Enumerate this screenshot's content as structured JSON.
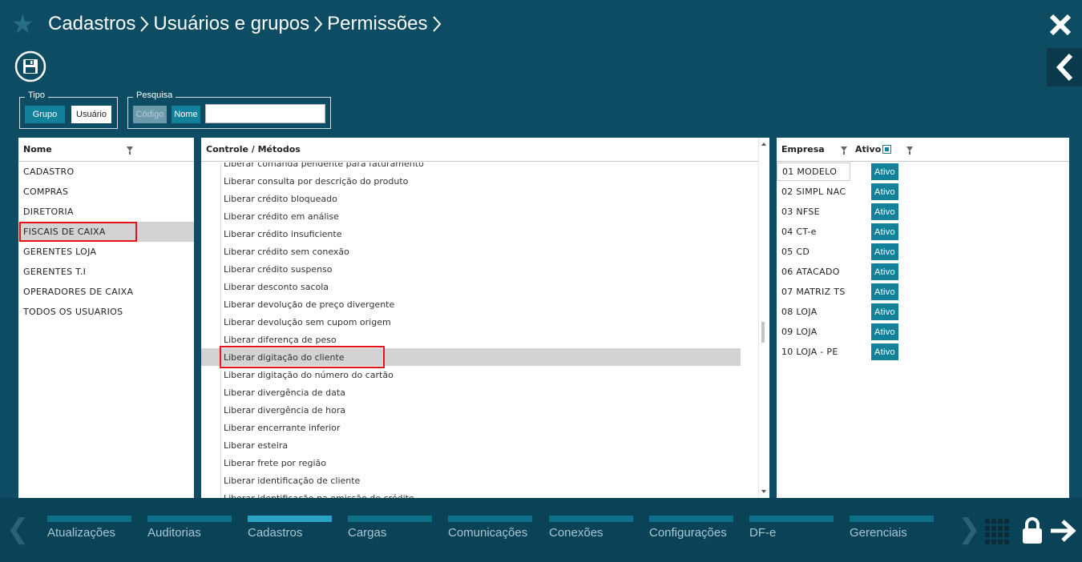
{
  "header": {
    "breadcrumb": [
      "Cadastros",
      "Usuários e grupos",
      "Permissões"
    ]
  },
  "tipo": {
    "legend": "Tipo",
    "grupo": "Grupo",
    "usuario": "Usuário"
  },
  "pesquisa": {
    "legend": "Pesquisa",
    "codigo": "Código",
    "nome": "Nome",
    "value": ""
  },
  "nome_panel": {
    "header": "Nome",
    "items": [
      "CADASTRO",
      "COMPRAS",
      "DIRETORIA",
      "FISCAIS DE CAIXA",
      "GERENTES LOJA",
      "GERENTES T.I",
      "OPERADORES DE CAIXA",
      "TODOS OS USUARIOS"
    ],
    "selected_index": 3
  },
  "controle_panel": {
    "header": "Controle / Métodos",
    "items": [
      "Liberar comanda pendente para faturamento",
      "Liberar consulta por descrição do produto",
      "Liberar crédito bloqueado",
      "Liberar crédito em análise",
      "Liberar crédito insuficiente",
      "Liberar crédito sem conexão",
      "Liberar crédito suspenso",
      "Liberar desconto sacola",
      "Liberar devolução de preço divergente",
      "Liberar devolução sem cupom origem",
      "Liberar diferença de peso",
      "Liberar digitação do cliente",
      "Liberar digitação do número do cartão",
      "Liberar divergência de data",
      "Liberar divergência de hora",
      "Liberar encerrante inferior",
      "Liberar esteira",
      "Liberar frete por região",
      "Liberar identificação de cliente",
      "Liberar identificação na emissão de crédito"
    ],
    "selected_index": 11
  },
  "empresa_panel": {
    "header_empresa": "Empresa",
    "header_ativo": "Ativo",
    "ativo_label": "Ativo",
    "items": [
      "01 MODELO",
      "02 SIMPL NAC",
      "03 NFSE",
      "04 CT-e",
      "05 CD",
      "06 ATACADO",
      "07 MATRIZ TS",
      "08 LOJA",
      "09 LOJA",
      "10 LOJA - PE"
    ]
  },
  "footer": {
    "nav": [
      "Atualizações",
      "Auditorias",
      "Cadastros",
      "Cargas",
      "Comunicações",
      "Conexões",
      "Configurações",
      "DF-e",
      "Gerenciais"
    ],
    "active_index": 2
  },
  "colors": {
    "background": "#0d4c63",
    "accent": "#13819a",
    "highlight_border": "#e3121b",
    "selection": "#d3d3d3"
  },
  "icons": [
    "star-icon",
    "close-icon",
    "back-chevron-icon",
    "save-icon",
    "filter-icon",
    "apps-grid-icon",
    "lock-icon",
    "exit-arrow-icon"
  ]
}
